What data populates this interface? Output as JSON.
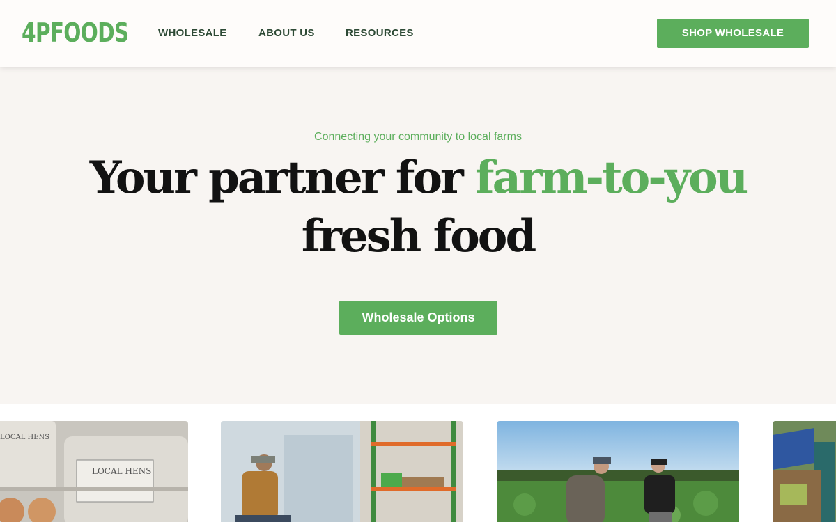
{
  "header": {
    "logo_text": "4PFOODS",
    "nav": [
      {
        "label": "WHOLESALE"
      },
      {
        "label": "ABOUT US"
      },
      {
        "label": "RESOURCES"
      }
    ],
    "cta_label": "SHOP WHOLESALE"
  },
  "hero": {
    "tagline": "Connecting your community to local farms",
    "headline_part1": "Your partner for ",
    "headline_highlight": "farm-to-you",
    "headline_part2": "fresh food",
    "button_label": "Wholesale Options"
  },
  "gallery": {
    "images": [
      {
        "name": "egg-cartons-photo",
        "carton_text": "LOCAL HENS"
      },
      {
        "name": "warehouse-worker-photo"
      },
      {
        "name": "farm-field-photo"
      },
      {
        "name": "market-stall-photo"
      }
    ]
  },
  "colors": {
    "brand_green": "#5cae5c",
    "nav_text": "#2d4a35",
    "hero_bg": "#f8f5f2",
    "headline": "#121212"
  }
}
